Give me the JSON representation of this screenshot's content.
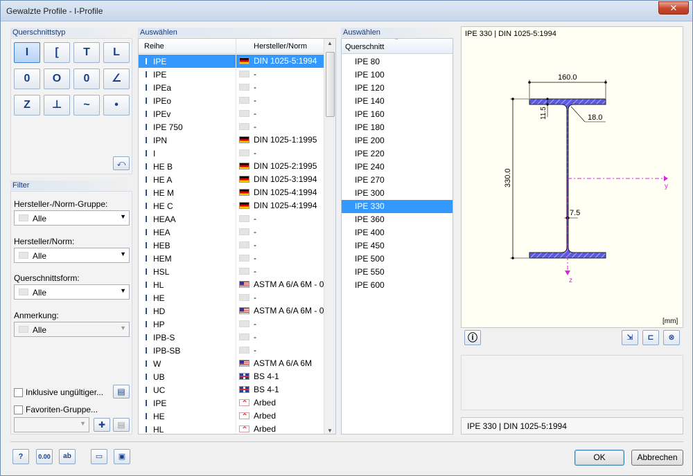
{
  "window": {
    "title": "Gewalzte Profile - I-Profile",
    "close": "✕"
  },
  "type_group": {
    "title": "Querschnittstyp",
    "buttons": [
      "I",
      "[",
      "T",
      "L",
      "0",
      "O",
      "0",
      "∠",
      "Z",
      "⊥",
      "~",
      "•"
    ]
  },
  "filter": {
    "title": "Filter",
    "manufacturer_group": {
      "label": "Hersteller-/Norm-Gruppe:",
      "value": "Alle"
    },
    "manufacturer": {
      "label": "Hersteller/Norm:",
      "value": "Alle"
    },
    "shape": {
      "label": "Querschnittsform:",
      "value": "Alle"
    },
    "note": {
      "label": "Anmerkung:",
      "value": "Alle"
    },
    "include_invalid": "Inklusive ungültiger...",
    "favorites": "Favoriten-Gruppe..."
  },
  "series_list": {
    "title": "Auswählen",
    "col_series": "Reihe",
    "col_norm": "Hersteller/Norm",
    "rows": [
      {
        "name": "IPE",
        "norm": "DIN 1025-5:1994",
        "flag": "de",
        "selected": true
      },
      {
        "name": "IPE",
        "norm": "-",
        "flag": "none"
      },
      {
        "name": "IPEa",
        "norm": "-",
        "flag": "none"
      },
      {
        "name": "IPEo",
        "norm": "-",
        "flag": "none"
      },
      {
        "name": "IPEv",
        "norm": "-",
        "flag": "none"
      },
      {
        "name": "IPE 750",
        "norm": "-",
        "flag": "none"
      },
      {
        "name": "IPN",
        "norm": "DIN 1025-1:1995",
        "flag": "de"
      },
      {
        "name": "I",
        "norm": "-",
        "flag": "none"
      },
      {
        "name": "HE B",
        "norm": "DIN 1025-2:1995",
        "flag": "de"
      },
      {
        "name": "HE A",
        "norm": "DIN 1025-3:1994",
        "flag": "de"
      },
      {
        "name": "HE M",
        "norm": "DIN 1025-4:1994",
        "flag": "de"
      },
      {
        "name": "HE C",
        "norm": "DIN 1025-4:1994",
        "flag": "de"
      },
      {
        "name": "HEAA",
        "norm": "-",
        "flag": "none"
      },
      {
        "name": "HEA",
        "norm": "-",
        "flag": "none"
      },
      {
        "name": "HEB",
        "norm": "-",
        "flag": "none"
      },
      {
        "name": "HEM",
        "norm": "-",
        "flag": "none"
      },
      {
        "name": "HSL",
        "norm": "-",
        "flag": "none"
      },
      {
        "name": "HL",
        "norm": "ASTM A 6/A 6M - 0",
        "flag": "us"
      },
      {
        "name": "HE",
        "norm": "-",
        "flag": "none"
      },
      {
        "name": "HD",
        "norm": "ASTM A 6/A 6M - 0",
        "flag": "us"
      },
      {
        "name": "HP",
        "norm": "-",
        "flag": "none"
      },
      {
        "name": "IPB-S",
        "norm": "-",
        "flag": "none"
      },
      {
        "name": "IPB-SB",
        "norm": "-",
        "flag": "none"
      },
      {
        "name": "W",
        "norm": "ASTM A 6/A 6M",
        "flag": "us"
      },
      {
        "name": "UB",
        "norm": "BS 4-1",
        "flag": "gb"
      },
      {
        "name": "UC",
        "norm": "BS 4-1",
        "flag": "gb"
      },
      {
        "name": "IPE",
        "norm": "Arbed",
        "flag": "arbed"
      },
      {
        "name": "HE",
        "norm": "Arbed",
        "flag": "arbed"
      },
      {
        "name": "HL",
        "norm": "Arbed",
        "flag": "arbed"
      }
    ]
  },
  "section_list": {
    "title": "Auswählen",
    "col": "Querschnitt",
    "items": [
      "IPE 80",
      "IPE 100",
      "IPE 120",
      "IPE 140",
      "IPE 160",
      "IPE 180",
      "IPE 200",
      "IPE 220",
      "IPE 240",
      "IPE 270",
      "IPE 300",
      "IPE 330",
      "IPE 360",
      "IPE 400",
      "IPE 450",
      "IPE 500",
      "IPE 550",
      "IPE 600"
    ],
    "selected": "IPE 330"
  },
  "preview": {
    "caption": "IPE 330 | DIN 1025-5:1994",
    "dim_width": "160.0",
    "dim_height": "330.0",
    "dim_flange": "11.5",
    "dim_radius": "18.0",
    "dim_web": "7.5",
    "axis_y": "y",
    "axis_z": "z",
    "unit": "[mm]",
    "status": "IPE 330 | DIN 1025-5:1994"
  },
  "buttons": {
    "ok": "OK",
    "cancel": "Abbrechen"
  },
  "colors": {
    "selection": "#3399ff",
    "section_fill": "#5a5ae0",
    "axis": "#e020e0"
  }
}
